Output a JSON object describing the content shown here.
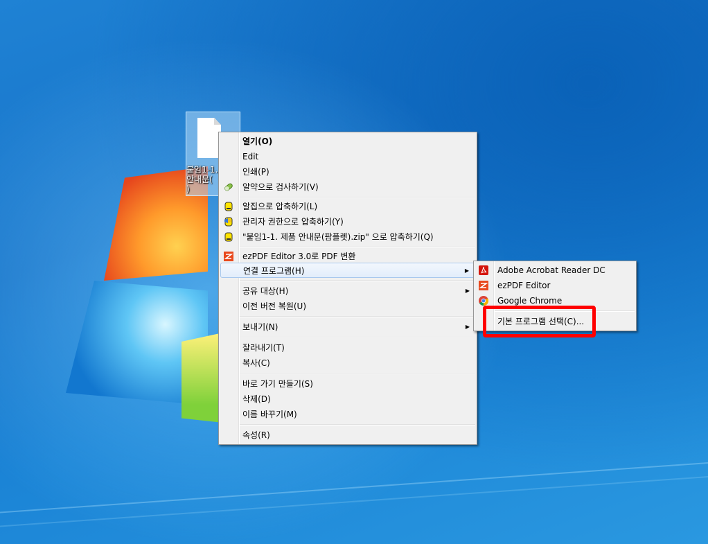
{
  "desktop": {
    "file_label": "붙임1-1.\n안내문(\n)"
  },
  "context_menu": {
    "items": [
      {
        "label": "열기(O)",
        "bold": true
      },
      {
        "label": "Edit"
      },
      {
        "label": "인쇄(P)"
      },
      {
        "label": "알약으로 검사하기(V)",
        "icon": "alyac-pill-icon"
      },
      {
        "label": "알집으로 압축하기(L)",
        "icon": "alzip-icon"
      },
      {
        "label": "관리자 권한으로 압축하기(Y)",
        "icon": "alzip-admin-icon"
      },
      {
        "label": "\"붙임1-1. 제품 안내문(팜플렛).zip\" 으로 압축하기(Q)",
        "icon": "alzip-icon"
      },
      {
        "label": "ezPDF Editor 3.0로 PDF 변환",
        "icon": "ezpdf-icon"
      },
      {
        "label": "연결 프로그램(H)",
        "submenu": true
      },
      {
        "label": "공유 대상(H)",
        "submenu": true
      },
      {
        "label": "이전 버전 복원(U)"
      },
      {
        "label": "보내기(N)",
        "submenu": true
      },
      {
        "label": "잘라내기(T)"
      },
      {
        "label": "복사(C)"
      },
      {
        "label": "바로 가기 만들기(S)"
      },
      {
        "label": "삭제(D)"
      },
      {
        "label": "이름 바꾸기(M)"
      },
      {
        "label": "속성(R)"
      }
    ]
  },
  "open_with_submenu": {
    "items": [
      {
        "label": "Adobe Acrobat Reader DC",
        "icon": "acrobat-icon"
      },
      {
        "label": "ezPDF Editor",
        "icon": "ezpdf-editor-icon"
      },
      {
        "label": "Google Chrome",
        "icon": "chrome-icon"
      },
      {
        "label": "기본 프로그램 선택(C)..."
      }
    ]
  },
  "colors": {
    "highlight_box": "#ff0000",
    "menu_background": "#f0f0f0",
    "desktop_blue": "#1672c8"
  }
}
